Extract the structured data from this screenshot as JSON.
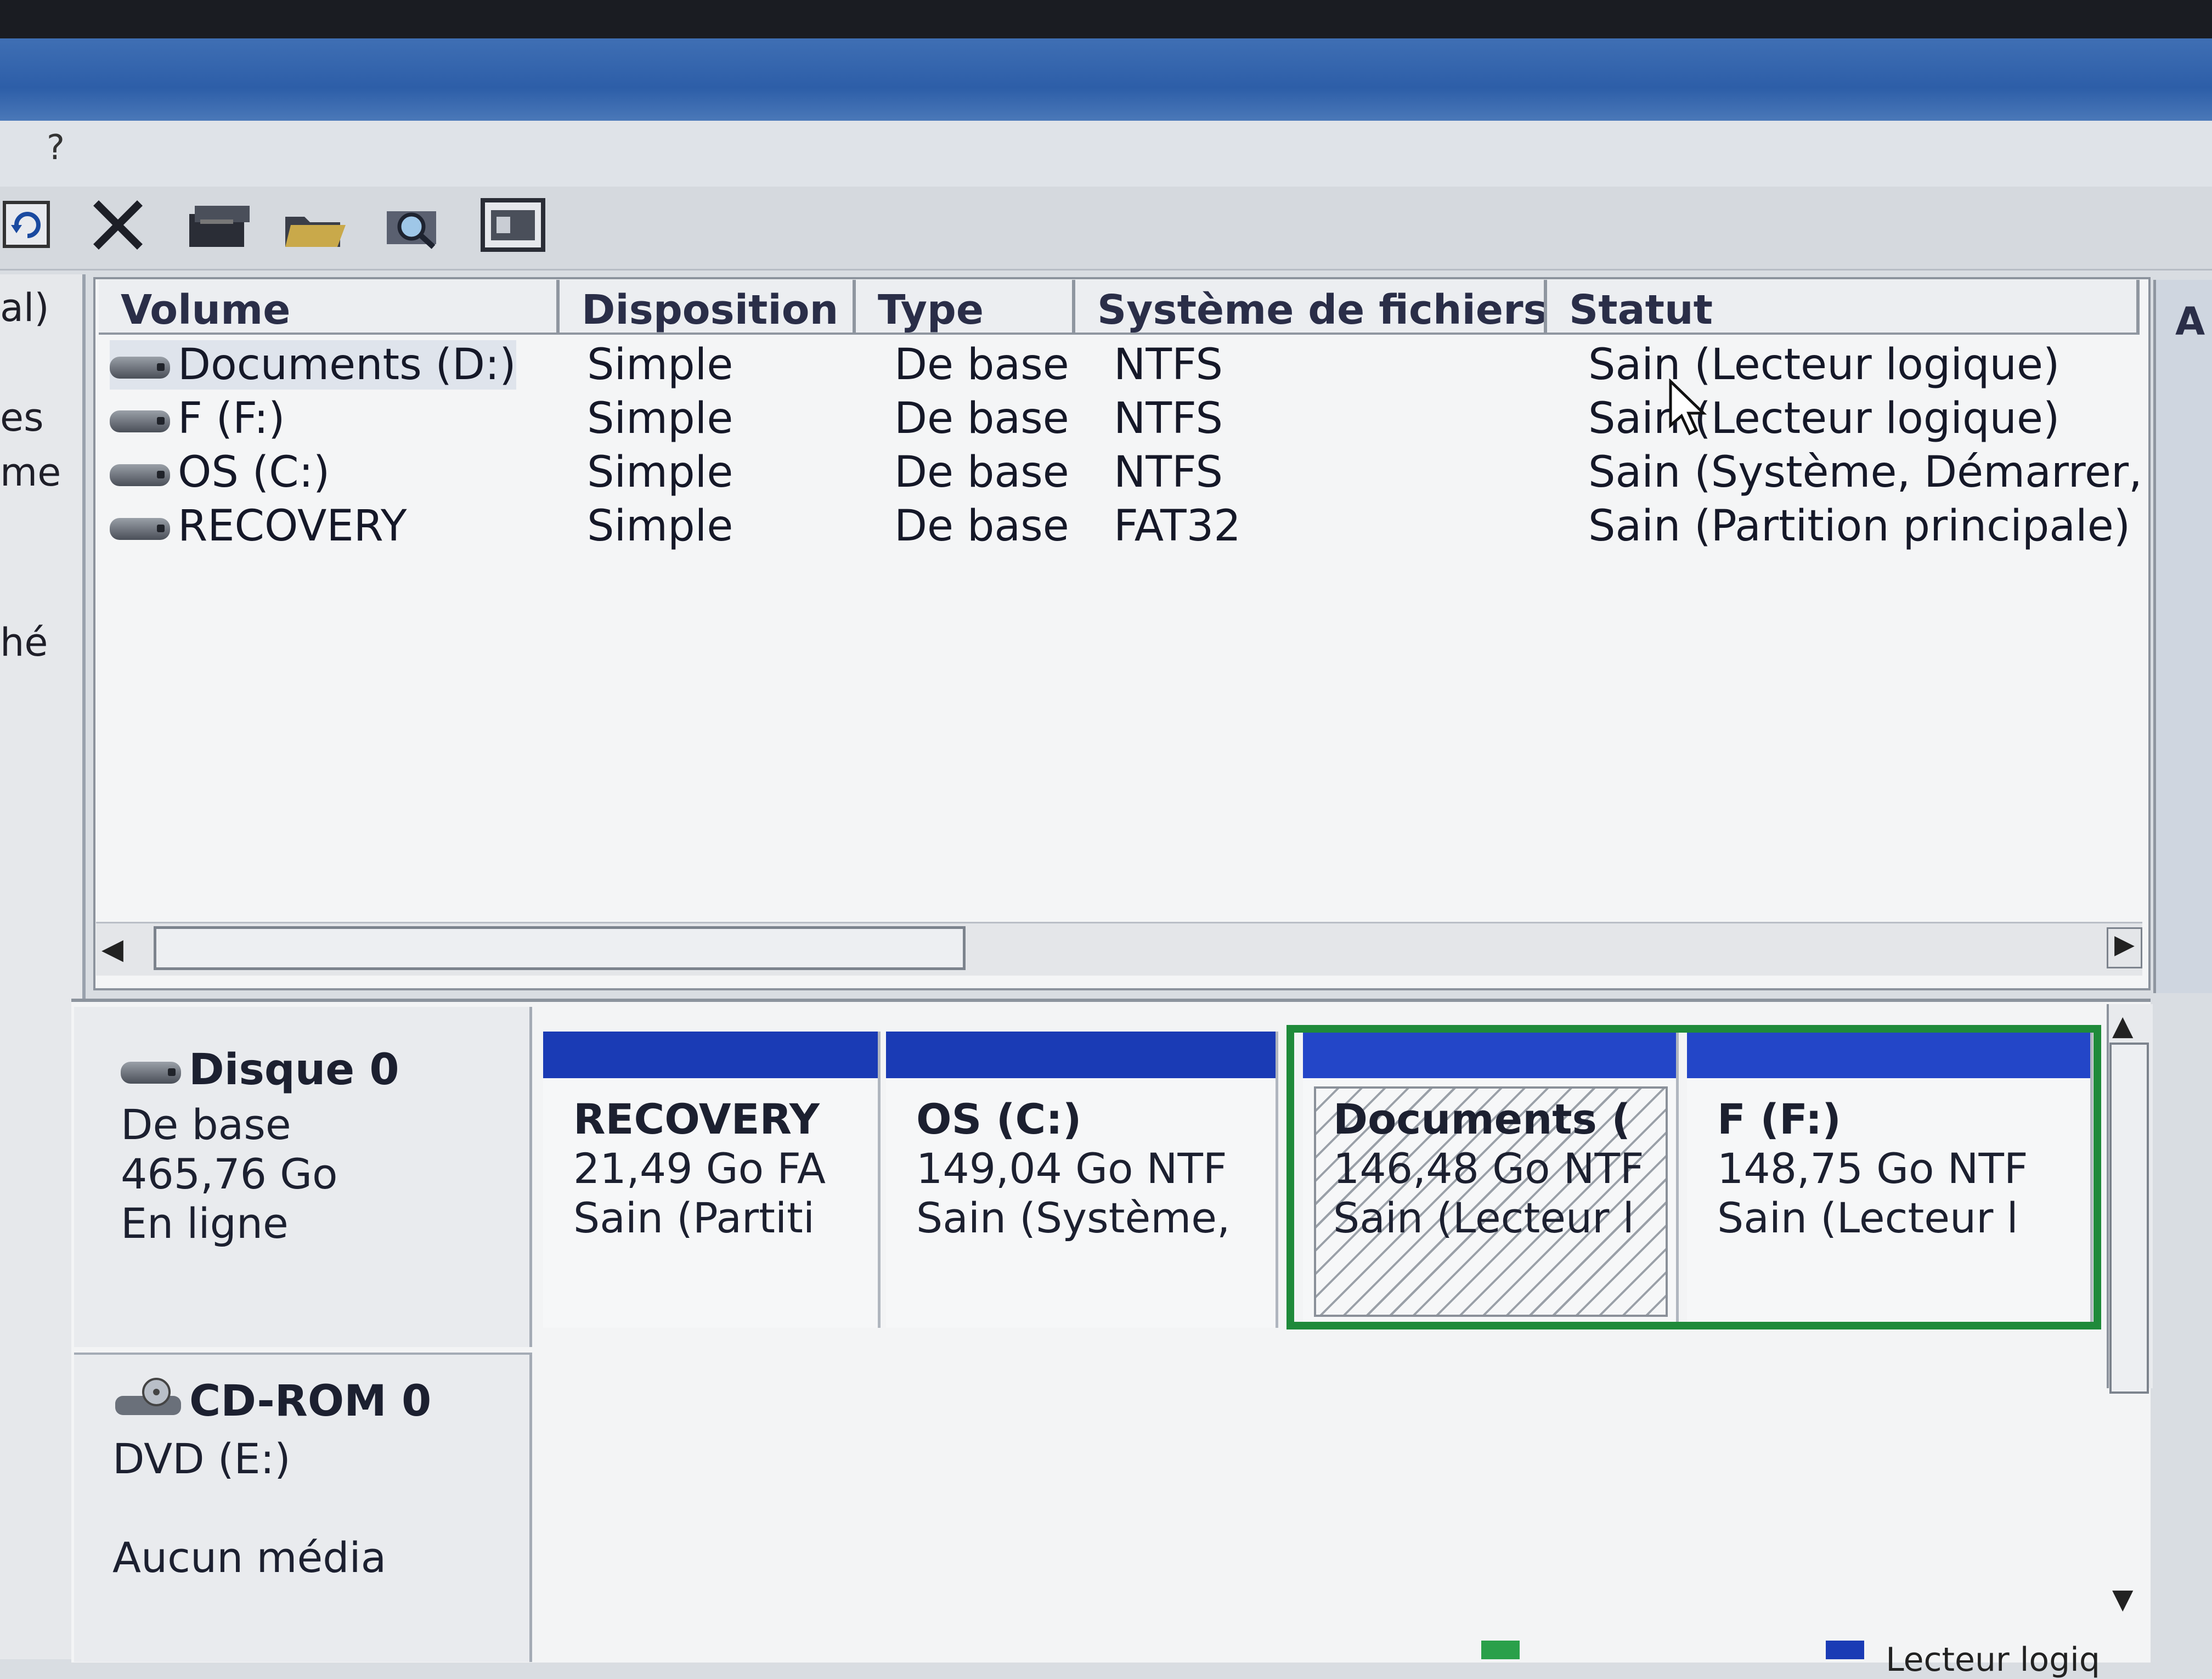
{
  "menu": {
    "help": "?"
  },
  "toolbar": {
    "icons": [
      "refresh-icon",
      "delete-icon",
      "properties-icon",
      "open-folder-icon",
      "search-icon",
      "console-icon"
    ]
  },
  "left_panel": {
    "fragments": [
      "al)",
      "es",
      "me",
      "hé"
    ]
  },
  "volume_list": {
    "columns": [
      "Volume",
      "Disposition",
      "Type",
      "Système de fichiers",
      "Statut"
    ],
    "right_column_fragment": "A",
    "rows": [
      {
        "volume": "Documents (D:)",
        "disposition": "Simple",
        "type": "De base",
        "fs": "NTFS",
        "status": "Sain (Lecteur logique)"
      },
      {
        "volume": "F (F:)",
        "disposition": "Simple",
        "type": "De base",
        "fs": "NTFS",
        "status": "Sain (Lecteur logique)"
      },
      {
        "volume": "OS (C:)",
        "disposition": "Simple",
        "type": "De base",
        "fs": "NTFS",
        "status": "Sain (Système, Démarrer,"
      },
      {
        "volume": "RECOVERY",
        "disposition": "Simple",
        "type": "De base",
        "fs": "FAT32",
        "status": "Sain (Partition principale)"
      }
    ]
  },
  "scroll": {
    "left": "◀",
    "right": "▶",
    "up": "▲",
    "down": "▼"
  },
  "disk0": {
    "title": "Disque 0",
    "type": "De base",
    "size": "465,76 Go",
    "state": "En ligne",
    "partitions": [
      {
        "name": "RECOVERY",
        "size": "21,49 Go FA",
        "status": "Sain (Partiti"
      },
      {
        "name": "OS  (C:)",
        "size": "149,04 Go NTF",
        "status": "Sain (Système,"
      },
      {
        "name": "Documents  (",
        "size": "146,48 Go NTF",
        "status": "Sain (Lecteur l"
      },
      {
        "name": "F  (F:)",
        "size": "148,75 Go NTF",
        "status": "Sain (Lecteur l"
      }
    ]
  },
  "cdrom0": {
    "title": "CD-ROM 0",
    "drive": "DVD (E:)",
    "media": "Aucun média"
  },
  "legend": {
    "text": "Lecteur logiq",
    "colors": [
      "#2aa04a",
      "#1a3bb5"
    ]
  }
}
